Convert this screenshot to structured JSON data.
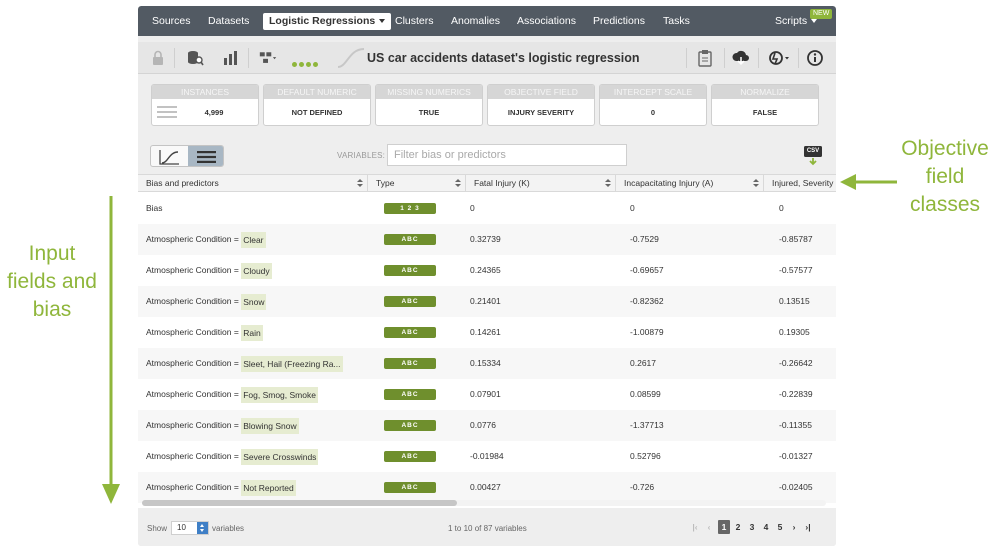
{
  "nav": {
    "items": [
      "Sources",
      "Datasets",
      "Logistic Regressions",
      "Clusters",
      "Anomalies",
      "Associations",
      "Predictions",
      "Tasks",
      "Scripts"
    ],
    "badge": "NEW"
  },
  "toolbar": {
    "title": "US car accidents dataset's logistic regression",
    "icons": [
      "lock-icon",
      "dataset-search-icon",
      "chart-icon",
      "tree-model-icon",
      "clipboard-icon",
      "cloud-download-icon",
      "actions-icon",
      "info-icon"
    ]
  },
  "summary": [
    {
      "label": "INSTANCES",
      "value": "4,999"
    },
    {
      "label": "DEFAULT NUMERIC",
      "value": "NOT DEFINED"
    },
    {
      "label": "MISSING NUMERICS",
      "value": "TRUE"
    },
    {
      "label": "OBJECTIVE FIELD",
      "value": "INJURY SEVERITY"
    },
    {
      "label": "INTERCEPT SCALE",
      "value": "0"
    },
    {
      "label": "NORMALIZE",
      "value": "FALSE"
    }
  ],
  "controls": {
    "variables_label": "VARIABLES:",
    "filter_placeholder": "Filter bias or predictors",
    "csv_label": "CSV"
  },
  "table": {
    "columns": [
      "Bias and predictors",
      "Type",
      "Fatal Injury (K)",
      "Incapacitating Injury (A)",
      "Injured, Severity"
    ],
    "rows": [
      {
        "prefix": "",
        "name": "Bias",
        "type": "1 2 3",
        "fatal": "0",
        "incap": "0",
        "injured": "0"
      },
      {
        "prefix": "Atmospheric Condition = ",
        "name": "Clear",
        "type": "ABC",
        "fatal": "0.32739",
        "incap": "-0.7529",
        "injured": "-0.85787"
      },
      {
        "prefix": "Atmospheric Condition = ",
        "name": "Cloudy",
        "type": "ABC",
        "fatal": "0.24365",
        "incap": "-0.69657",
        "injured": "-0.57577"
      },
      {
        "prefix": "Atmospheric Condition = ",
        "name": "Snow",
        "type": "ABC",
        "fatal": "0.21401",
        "incap": "-0.82362",
        "injured": "0.13515"
      },
      {
        "prefix": "Atmospheric Condition = ",
        "name": "Rain",
        "type": "ABC",
        "fatal": "0.14261",
        "incap": "-1.00879",
        "injured": "0.19305"
      },
      {
        "prefix": "Atmospheric Condition = ",
        "name": "Sleet, Hail (Freezing Ra...",
        "type": "ABC",
        "fatal": "0.15334",
        "incap": "0.2617",
        "injured": "-0.26642"
      },
      {
        "prefix": "Atmospheric Condition = ",
        "name": "Fog, Smog, Smoke",
        "type": "ABC",
        "fatal": "0.07901",
        "incap": "0.08599",
        "injured": "-0.22839"
      },
      {
        "prefix": "Atmospheric Condition = ",
        "name": "Blowing Snow",
        "type": "ABC",
        "fatal": "0.0776",
        "incap": "-1.37713",
        "injured": "-0.11355"
      },
      {
        "prefix": "Atmospheric Condition = ",
        "name": "Severe Crosswinds",
        "type": "ABC",
        "fatal": "-0.01984",
        "incap": "0.52796",
        "injured": "-0.01327"
      },
      {
        "prefix": "Atmospheric Condition = ",
        "name": "Not Reported",
        "type": "ABC",
        "fatal": "0.00427",
        "incap": "-0.726",
        "injured": "-0.02405"
      }
    ],
    "scroll_fraction": 0.46
  },
  "footer": {
    "show_label": "Show",
    "page_size": "10",
    "variables_label": "variables",
    "range_text": "1 to 10 of 87 variables",
    "pages": [
      "1",
      "2",
      "3",
      "4",
      "5"
    ],
    "current_page": "1"
  },
  "annotations": {
    "left": "Input fields and bias",
    "right": "Objective field classes"
  },
  "colors": {
    "accent": "#8fb63b",
    "nav_bg": "#525a63",
    "type_badge": "#6f8f2d",
    "highlight": "#e6ecd1"
  }
}
